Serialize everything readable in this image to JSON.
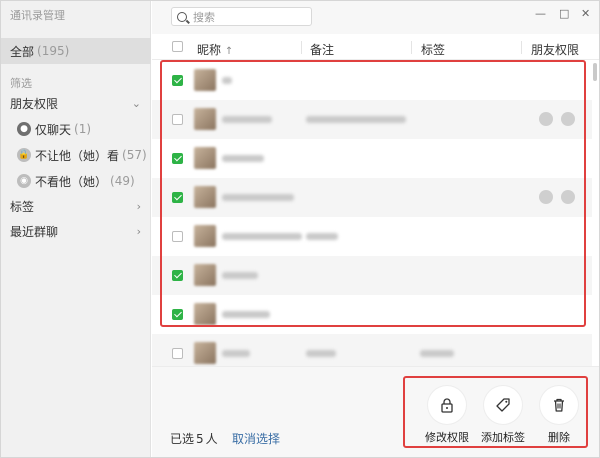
{
  "app_title": "通讯录管理",
  "sidebar": {
    "all_label": "全部",
    "all_count": "(195)",
    "filter_label": "筛选",
    "friend_perm_label": "朋友权限",
    "perm_items": [
      {
        "label": "仅聊天",
        "count": "(1)",
        "icon": "user-icon"
      },
      {
        "label": "不让他（她）看",
        "count": "(57)",
        "icon": "lock-icon"
      },
      {
        "label": "不看他（她）",
        "count": "(49)",
        "icon": "eye-icon"
      }
    ],
    "tags_label": "标签",
    "recent_groups_label": "最近群聊"
  },
  "search": {
    "placeholder": "搜索"
  },
  "window_controls": {
    "minimize": "—",
    "maximize": "□",
    "close": "✕"
  },
  "table": {
    "headers": {
      "nickname": "昵称",
      "sort_arrow": "↑",
      "remark": "备注",
      "tag": "标签",
      "permission": "朋友权限"
    },
    "rows": [
      {
        "checked": true
      },
      {
        "checked": false
      },
      {
        "checked": true
      },
      {
        "checked": true
      },
      {
        "checked": false
      },
      {
        "checked": true
      },
      {
        "checked": true
      },
      {
        "checked": false
      }
    ]
  },
  "footer": {
    "selected_prefix": "已选",
    "selected_count": "5",
    "selected_suffix": "人",
    "cancel_selection": "取消选择",
    "actions": [
      {
        "label": "修改权限",
        "icon": "lock-icon"
      },
      {
        "label": "添加标签",
        "icon": "tag-icon"
      },
      {
        "label": "删除",
        "icon": "trash-icon"
      }
    ]
  },
  "colors": {
    "accent_green": "#2eb346",
    "highlight_red": "#e0403f",
    "link_blue": "#3a6ea5"
  }
}
